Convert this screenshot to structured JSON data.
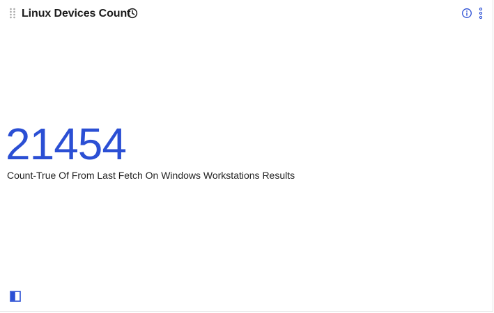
{
  "widget": {
    "title": "Linux Devices Count",
    "value": "21454",
    "caption": "Count-True Of From Last Fetch On Windows Workstations Results"
  },
  "colors": {
    "accent": "#2b4fd4",
    "title_text": "#1a1a1a",
    "icon_gray": "#a8a8a8"
  },
  "icons": {
    "drag": "drag-handle-icon",
    "clock": "clock-icon",
    "info": "info-icon",
    "more": "more-vertical-icon",
    "panel": "panel-toggle-icon"
  }
}
